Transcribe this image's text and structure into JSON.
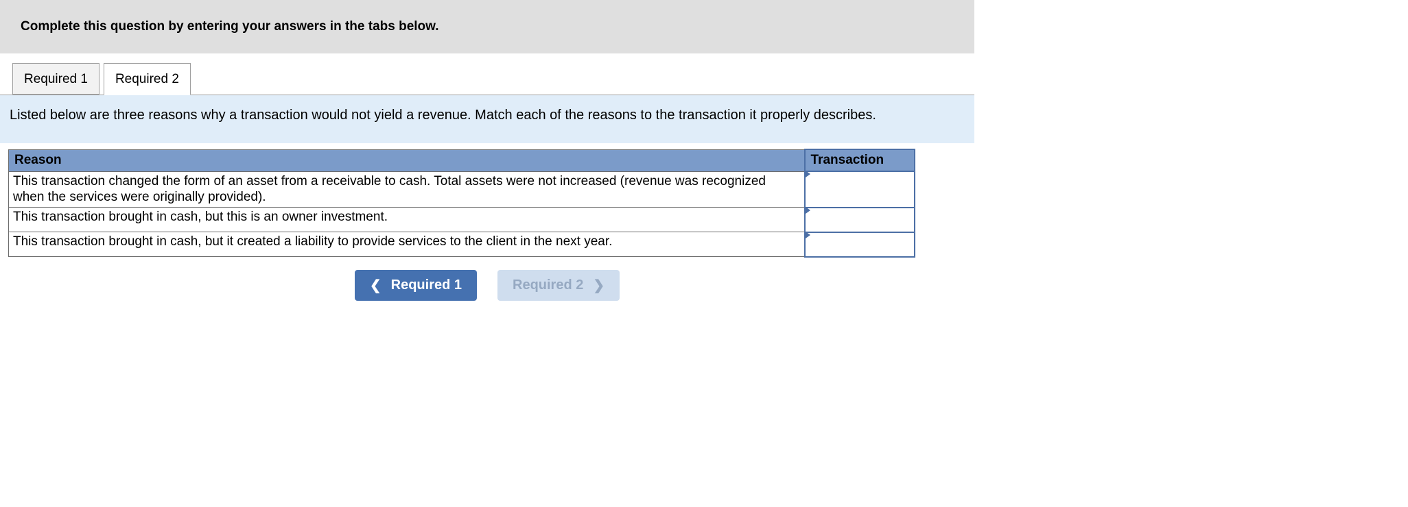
{
  "instruction": "Complete this question by entering your answers in the tabs below.",
  "tabs": [
    {
      "label": "Required 1",
      "active": false
    },
    {
      "label": "Required 2",
      "active": true
    }
  ],
  "question_text": "Listed below are three reasons why a transaction would not yield a revenue. Match each of the reasons to the transaction it properly describes.",
  "table": {
    "headers": {
      "reason": "Reason",
      "transaction": "Transaction"
    },
    "rows": [
      {
        "reason": "This transaction changed the form of an asset from a receivable to cash. Total assets were not increased (revenue was recognized when the services were originally provided).",
        "value": ""
      },
      {
        "reason": "This transaction brought in cash, but this is an owner investment.",
        "value": ""
      },
      {
        "reason": "This transaction brought in cash, but it created a liability to provide services to the client in the next year.",
        "value": ""
      }
    ]
  },
  "nav": {
    "prev": "Required 1",
    "next": "Required 2"
  }
}
